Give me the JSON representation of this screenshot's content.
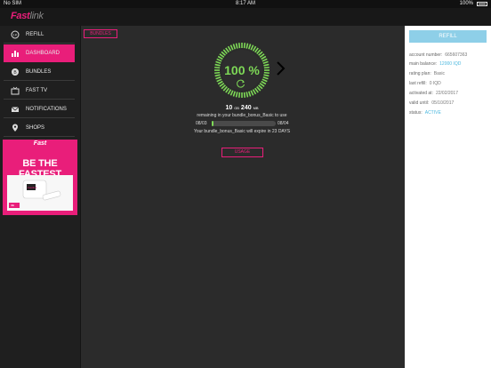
{
  "status_bar": {
    "carrier": "No SIM",
    "time": "8:17 AM",
    "battery": "100%"
  },
  "app": {
    "logo_main": "Fast",
    "logo_tail": "link"
  },
  "sidebar": {
    "items": [
      {
        "label": "REFILL",
        "icon": "refill-icon"
      },
      {
        "label": "DASHBOARD",
        "icon": "bar-chart-icon",
        "active": true
      },
      {
        "label": "BUNDLES",
        "icon": "bundles-icon"
      },
      {
        "label": "FAST TV",
        "icon": "tv-icon"
      },
      {
        "label": "NOTIFICATIONS",
        "icon": "envelope-icon"
      },
      {
        "label": "SHOPS",
        "icon": "map-pin-icon"
      }
    ],
    "ad": {
      "brand": "Fast",
      "headline": "BE THE FASTEST",
      "device_label": "Fastlink",
      "badge": "4G"
    }
  },
  "main": {
    "bundles_button": "BUNDLES",
    "gauge_percent": 100,
    "gauge_label": "100 %",
    "amount_value": "10",
    "amount_unit_gb": "GB",
    "amount_mb": "240",
    "amount_unit_mb": "MB",
    "remaining_text": "remaining in your bundle_bonus_Basic to use",
    "date_from": "08/03",
    "date_to": "08/04",
    "progress_fraction": 0.03,
    "expire_text": "Your bundle_bonus_Basic will expire in 23 DAYS",
    "usage_button": "USAGE"
  },
  "account": {
    "refill_button": "REFILL",
    "rows": [
      {
        "label": "account number:",
        "value": "665607363",
        "blue": false
      },
      {
        "label": "main balance:",
        "value": "12000 IQD",
        "blue": true
      },
      {
        "label": "rating plan:",
        "value": "Basic",
        "blue": false
      },
      {
        "label": "last refill:",
        "value": "0 IQD",
        "blue": false
      },
      {
        "label": "activated at:",
        "value": "22/02/2017",
        "blue": false
      },
      {
        "label": "valid until:",
        "value": "05/10/2017",
        "blue": false
      },
      {
        "label": "status:",
        "value": "ACTIVE",
        "blue": true
      }
    ]
  },
  "colors": {
    "accent": "#e91e7a",
    "gauge": "#7ed957",
    "info_blue": "#4ab7de",
    "refill": "#8ecfe8"
  }
}
